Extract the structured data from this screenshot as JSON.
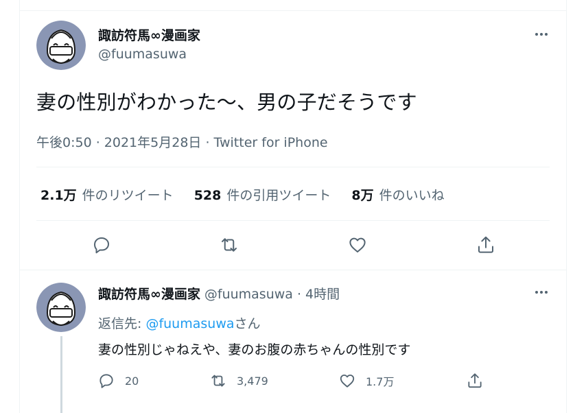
{
  "tweet": {
    "author": {
      "display_name": "諏訪符馬∞漫画家",
      "handle": "@fuumasuwa",
      "avatar": "avatar-face-icon"
    },
    "text": "妻の性別がわかった〜、男の子だそうです",
    "timestamp": "午後0:50 · 2021年5月28日",
    "separator": " · ",
    "source": "Twitter for iPhone",
    "stats": [
      {
        "value": "2.1万",
        "label": "件のリツイート"
      },
      {
        "value": "528",
        "label": "件の引用ツイート"
      },
      {
        "value": "8万",
        "label": "件のいいね"
      }
    ],
    "actions": [
      "reply-icon",
      "retweet-icon",
      "like-icon",
      "share-icon"
    ]
  },
  "reply": {
    "author": {
      "display_name": "諏訪符馬∞漫画家",
      "handle": "@fuumasuwa",
      "time": " · 4時間"
    },
    "replying_prefix": "返信先: ",
    "replying_mention": "@fuumasuwa",
    "replying_suffix": "さん",
    "text": "妻の性別じゃねえや、妻のお腹の赤ちゃんの性別です",
    "counts": {
      "replies": "20",
      "retweets": "3,479",
      "likes": "1.7万"
    }
  },
  "colors": {
    "accent": "#1d9bf0",
    "text": "#0f1419",
    "muted": "#536471",
    "border": "#eff3f4"
  }
}
